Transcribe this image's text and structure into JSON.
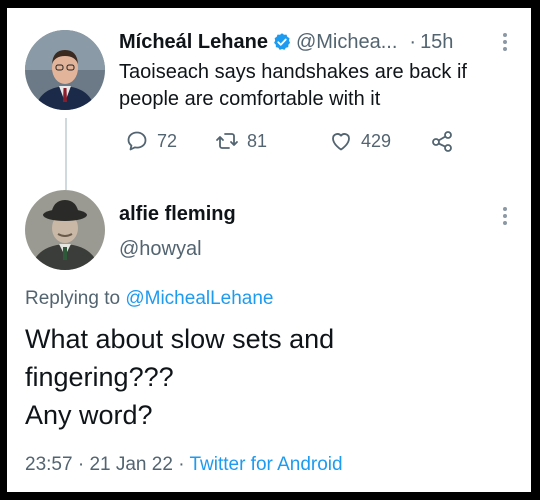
{
  "tweet": {
    "author_name": "Mícheál Lehane",
    "author_handle": "@Michea...",
    "time_separator": "·",
    "time": "15h",
    "text": "Taoiseach says handshakes are back if people are comfortable with it",
    "replies": "72",
    "retweets": "81",
    "likes": "429",
    "verified": true
  },
  "reply": {
    "author_name": "alfie fleming",
    "author_handle": "@howyal",
    "replying_prefix": "Replying to",
    "replying_to": "@MichealLehane",
    "text": "What about slow sets and\nfingering???\nAny word?",
    "time": "23:57",
    "sep1": "·",
    "date": "21 Jan 22",
    "sep2": "·",
    "source": "Twitter for Android"
  },
  "colors": {
    "accent": "#1d9bf0",
    "secondary_text": "#536471",
    "thread_line": "#cfd9de",
    "border": "#000000"
  },
  "icons": {
    "reply": "speech-bubble-icon",
    "retweet": "retweet-arrows-icon",
    "like": "heart-outline-icon",
    "share": "share-nodes-icon",
    "verified": "verified-badge-icon",
    "more": "vertical-ellipsis-icon"
  }
}
